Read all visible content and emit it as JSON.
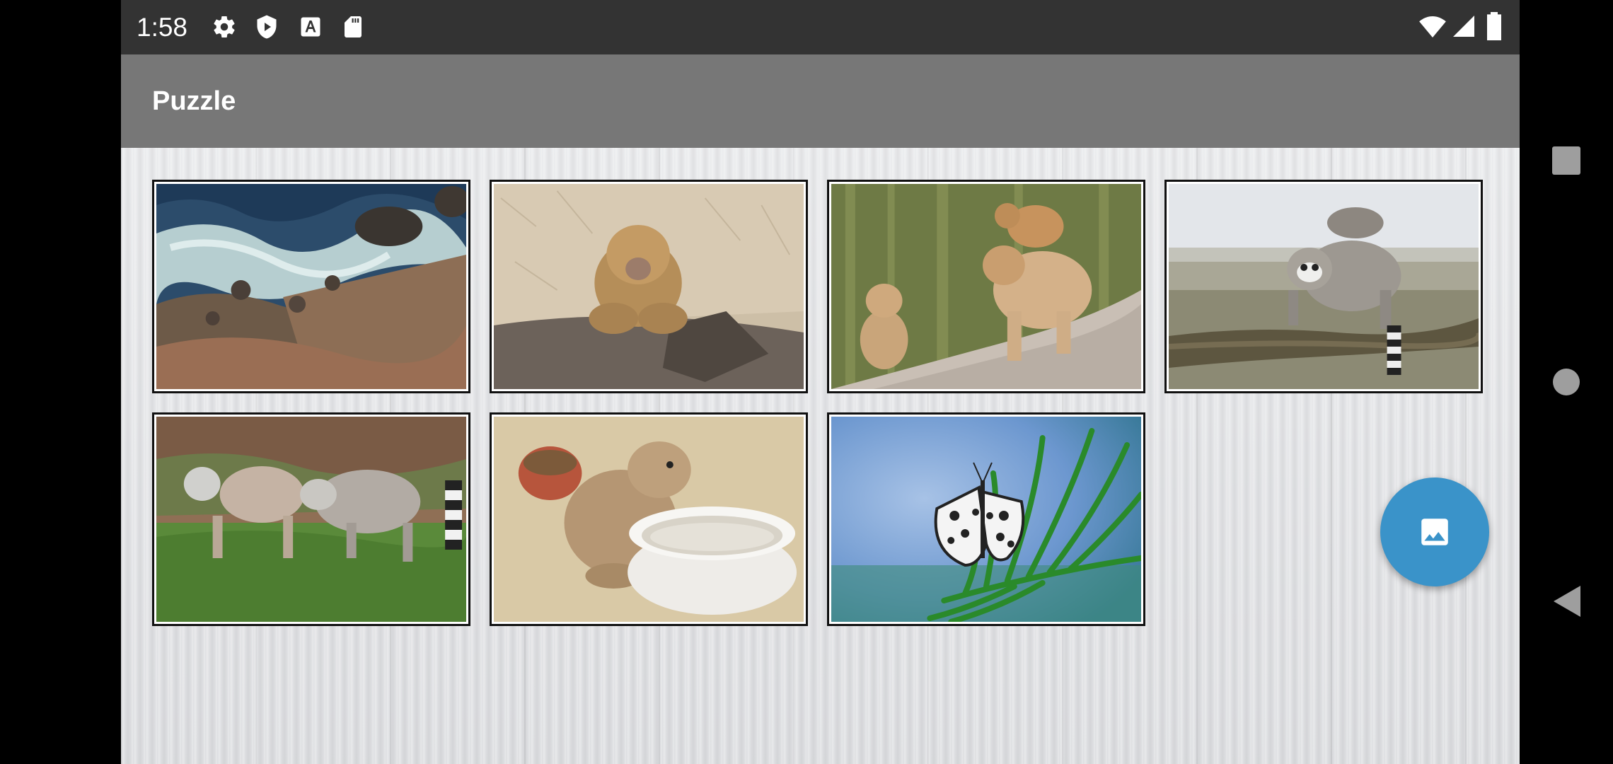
{
  "status_bar": {
    "time": "1:58",
    "left_icons": [
      "gear-icon",
      "shield-play-icon",
      "text-a-icon",
      "sd-card-icon"
    ],
    "right_icons": [
      "wifi-icon",
      "cell-signal-icon",
      "battery-icon"
    ]
  },
  "toolbar": {
    "title": "Puzzle"
  },
  "gallery": {
    "images": [
      {
        "subject": "rocky-coast"
      },
      {
        "subject": "barbary-macaque"
      },
      {
        "subject": "macaque-family"
      },
      {
        "subject": "lemur-on-branch"
      },
      {
        "subject": "ring-tailed-lemurs"
      },
      {
        "subject": "prairie-dog-bowl"
      },
      {
        "subject": "butterfly-on-palm"
      }
    ]
  },
  "fab": {
    "icon": "image-icon"
  },
  "nav": {
    "buttons": [
      "recents-square-icon",
      "home-circle-icon",
      "back-triangle-icon"
    ]
  },
  "colors": {
    "status_bar": "#333333",
    "toolbar": "#777777",
    "fab": "#3a93c9",
    "background": "#e4e5e8"
  }
}
